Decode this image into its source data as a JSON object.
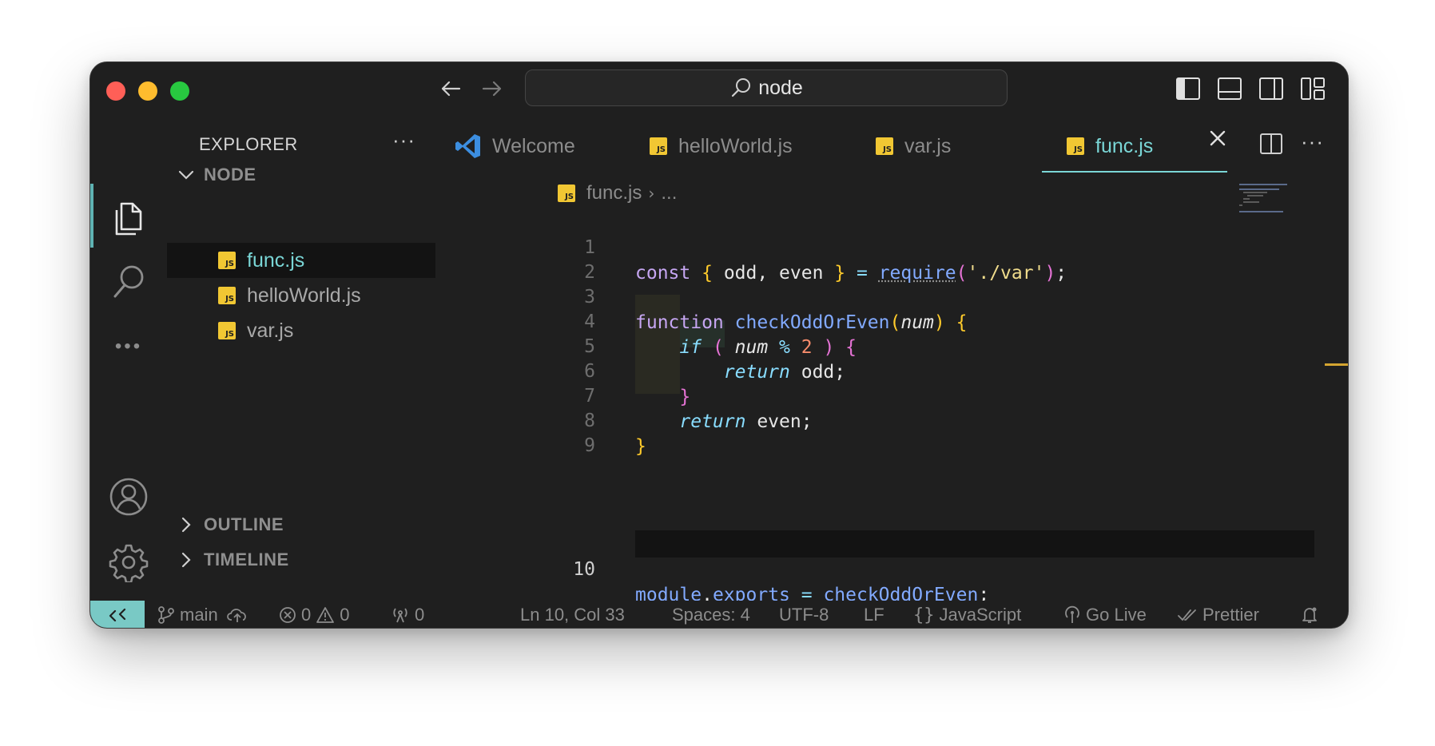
{
  "command_center": {
    "text": "node"
  },
  "sidebar": {
    "title": "EXPLORER",
    "more": "···",
    "folder": "NODE",
    "files": [
      {
        "name": "func.js",
        "active": true
      },
      {
        "name": "helloWorld.js",
        "active": false
      },
      {
        "name": "var.js",
        "active": false
      }
    ],
    "outline": "OUTLINE",
    "timeline": "TIMELINE"
  },
  "tabs": [
    {
      "label": "Welcome",
      "icon": "vscode-logo-icon"
    },
    {
      "label": "helloWorld.js",
      "icon": "js-file-icon"
    },
    {
      "label": "var.js",
      "icon": "js-file-icon"
    },
    {
      "label": "func.js",
      "icon": "js-file-icon",
      "active": true
    }
  ],
  "js_badge": "JS",
  "breadcrumb": {
    "file": "func.js",
    "rest": "..."
  },
  "editor": {
    "line_numbers": [
      "1",
      "2",
      "3",
      "4",
      "5",
      "6",
      "7",
      "8",
      "9",
      "10"
    ],
    "code": {
      "l1_const": "const",
      "l1_open": "{",
      "l1_vars": " odd, even ",
      "l1_close": "}",
      "l1_eq": " = ",
      "l1_req": "require",
      "l1_p1": "(",
      "l1_str": "'./var'",
      "l1_p2": ")",
      "l1_semi": ";",
      "l3_function": "function",
      "l3_name": " checkOddOrEven",
      "l3_p1": "(",
      "l3_param": "num",
      "l3_p2": ")",
      "l3_brace": " {",
      "l4_if": "if",
      "l4_p1": " ( ",
      "l4_num": "num",
      "l4_mod": " % ",
      "l4_two": "2",
      "l4_p2": " ) ",
      "l4_brace": "{",
      "l5_return": "return",
      "l5_val": " odd;",
      "l6_brace": "}",
      "l7_return": "return",
      "l7_val": " even;",
      "l8_brace": "}",
      "l10_module": "module",
      "l10_dot": ".",
      "l10_exports": "exports",
      "l10_eq": " = ",
      "l10_name": "checkOddOrEven",
      "l10_semi": ";"
    }
  },
  "status": {
    "branch": "main",
    "errors": "0",
    "warnings": "0",
    "ports": "0",
    "position": "Ln 10, Col 33",
    "spaces": "Spaces: 4",
    "encoding": "UTF-8",
    "eol": "LF",
    "language": "JavaScript",
    "go_live": "Go Live",
    "prettier": "Prettier"
  },
  "colors": {
    "accent": "#7ad6d6",
    "remote": "#79c9c5",
    "js_badge": "#f1c733",
    "close": "#ff5f57",
    "minimize": "#febc2e",
    "maximize": "#28c840"
  }
}
